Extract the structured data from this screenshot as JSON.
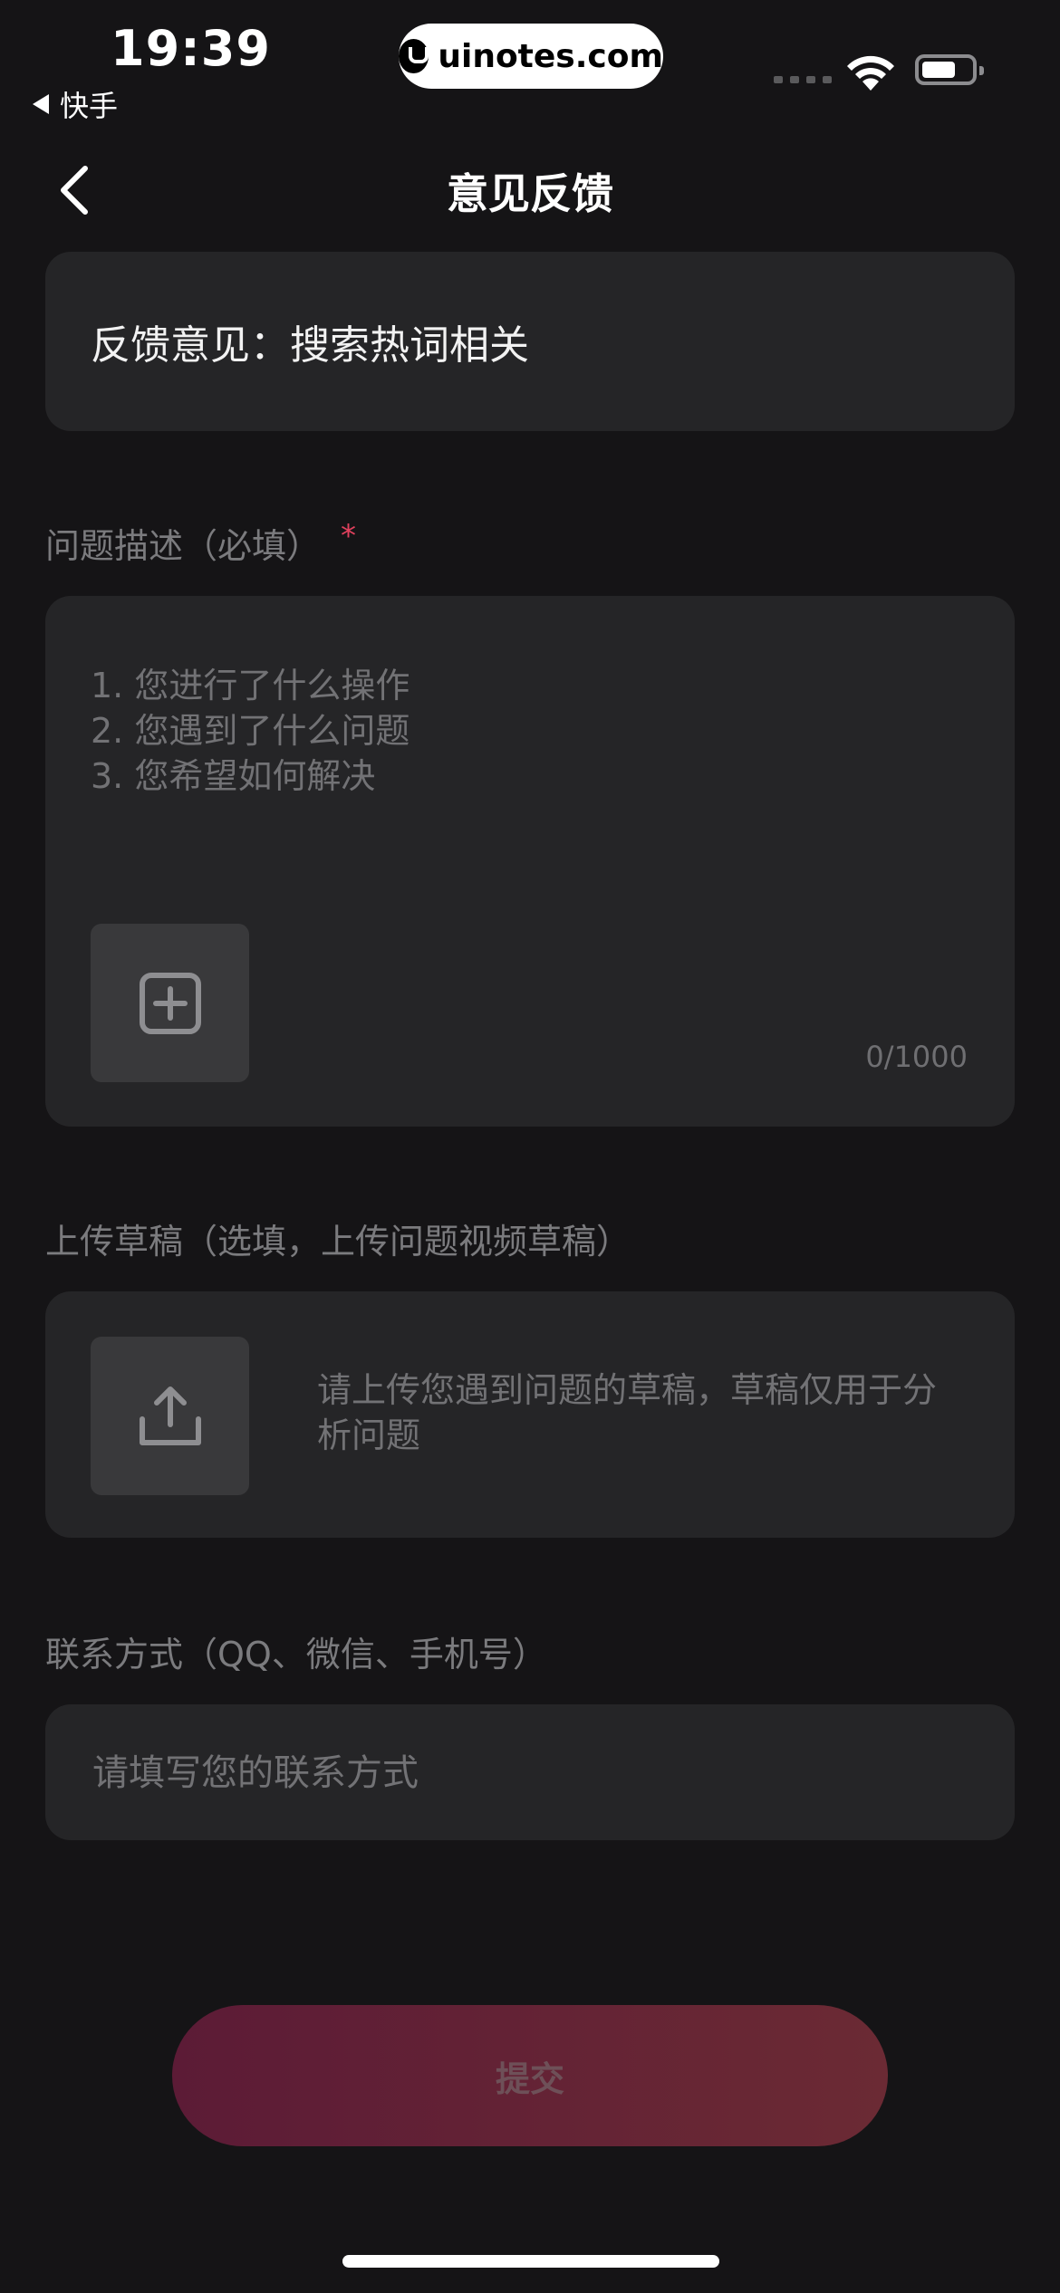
{
  "status_bar": {
    "time": "19:39",
    "back_app": "快手",
    "watermark": "uinotes.com"
  },
  "nav": {
    "title": "意见反馈"
  },
  "topic": {
    "text": "反馈意见：搜索热词相关"
  },
  "description": {
    "label": "问题描述（必填）",
    "required_mark": "*",
    "placeholder_lines": [
      "1. 您进行了什么操作",
      "2. 您遇到了什么问题",
      "3. 您希望如何解决"
    ],
    "counter": "0/1000"
  },
  "upload": {
    "label": "上传草稿（选填，上传问题视频草稿）",
    "hint": "请上传您遇到问题的草稿，草稿仅用于分析问题"
  },
  "contact": {
    "label": "联系方式（QQ、微信、手机号）",
    "placeholder": "请填写您的联系方式"
  },
  "submit": {
    "label": "提交"
  },
  "colors": {
    "background": "#151416",
    "card": "#252527",
    "required": "#e0415d",
    "submit_start": "#5c1b36",
    "submit_end": "#6b2a34"
  }
}
